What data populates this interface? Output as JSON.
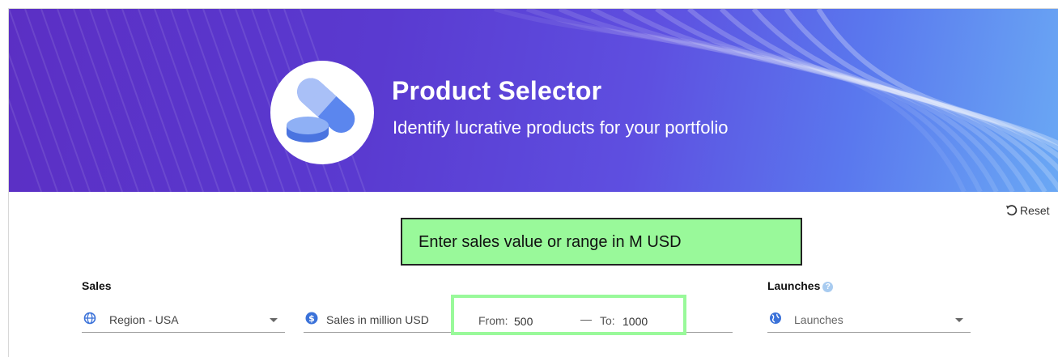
{
  "header": {
    "title": "Product Selector",
    "subtitle": "Identify lucrative products for your portfolio",
    "logo_icon": "pills-icon"
  },
  "toolbar": {
    "reset_label": "Reset",
    "reset_icon": "undo-icon"
  },
  "callout": {
    "text": "Enter sales value or range in M USD"
  },
  "filters": {
    "sales_label": "Sales",
    "launches_label": "Launches",
    "launches_help": "?",
    "region": {
      "icon": "globe-icon",
      "value": "Region - USA"
    },
    "sales_metric": {
      "icon": "dollar-circle-icon",
      "value": "Sales in million USD"
    },
    "range": {
      "from_label": "From:",
      "from_value": "500",
      "dash": "—",
      "to_label": "To:",
      "to_value": "1000"
    },
    "launches": {
      "icon": "globe-filled-icon",
      "value": "Launches"
    }
  },
  "colors": {
    "header_purple": "#5b2fc4",
    "header_blue": "#6aa8f4",
    "highlight_green": "#99f99a",
    "icon_blue": "#3b72d9"
  }
}
